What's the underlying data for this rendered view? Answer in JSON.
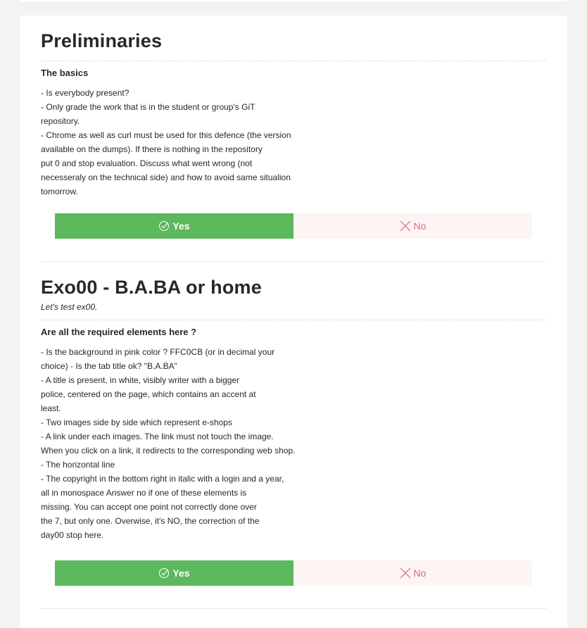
{
  "sections": [
    {
      "title": "Preliminaries",
      "subtitle": "",
      "question": "The basics",
      "lines": [
        "- Is everybody present?",
        "- Only grade the work that is in the student or group's GiT",
        "repository.",
        "- Chrome as well as curl must be used for this defence (the version",
        "available on the dumps). If there is nothing in the repository",
        "put 0 and stop evaluation. Discuss what went wrong (not",
        "necesseraly on the technical side) and how to avoid same situalion",
        "tomorrow."
      ],
      "yes_label": "Yes",
      "no_label": "No"
    },
    {
      "title": "Exo00 - B.A.BA or home",
      "subtitle": "Let's test ex00.",
      "question": "Are all the required elements here ?",
      "lines": [
        "- Is the background in pink color ? FFC0CB (or in decimal your",
        "choice) - Is the tab title ok? \"B.A.BA\"",
        "- A title is present, in white, visibly writer with a bigger",
        "police, centered on the page, which contains an accent at",
        "least.",
        "- Two images side by side which represent e-shops",
        "- A link under each images. The link must not touch the image.",
        "When you click on a link, it redirects to the corresponding web shop.",
        "- The horizontal line",
        "- The copyright in the bottom right in italic with a login and a year,",
        "all in monospace Answer no if one of these elements is",
        "missing. You can accept one point not correctly done over",
        "the 7, but only one. Overwise, it's NO, the correction of the",
        "day00 stop here."
      ],
      "yes_label": "Yes",
      "no_label": "No"
    }
  ],
  "colors": {
    "yes_bg": "#5cb85c",
    "no_bg": "#fdf4f4",
    "no_text": "#d9687a"
  },
  "icons": {
    "yes": "check-circle-icon",
    "no": "close-icon"
  }
}
